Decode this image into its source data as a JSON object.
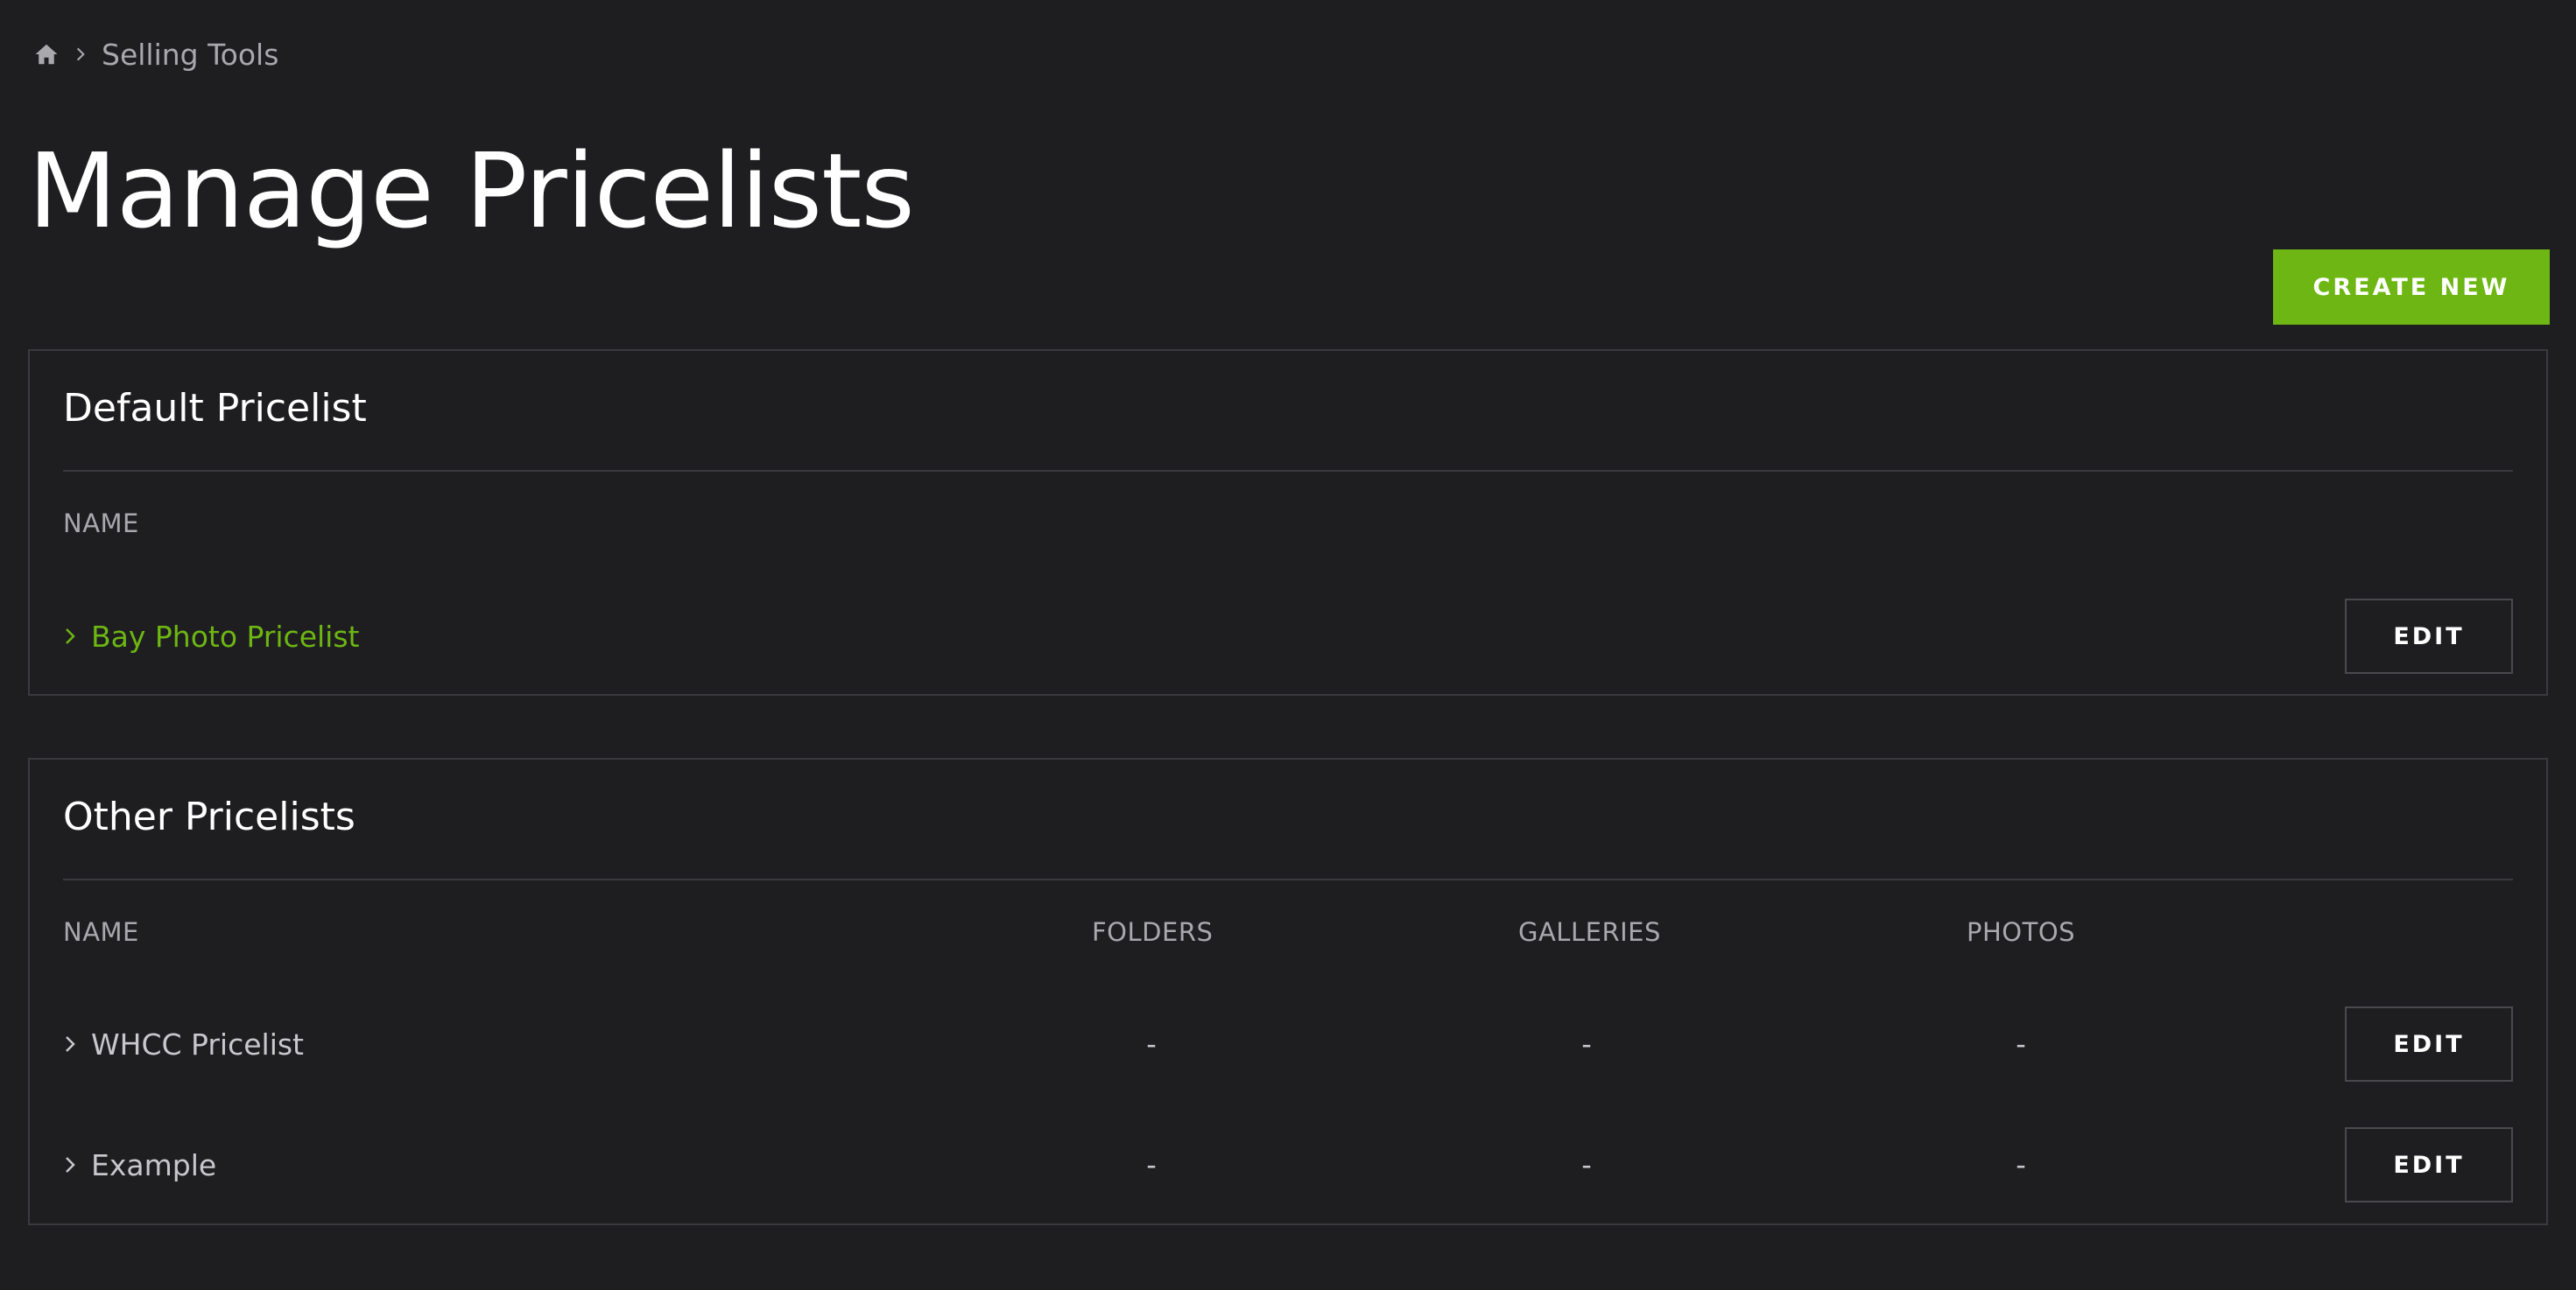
{
  "breadcrumb": {
    "home_icon": "home-icon",
    "separator_icon": "chevron-right-icon",
    "items": [
      {
        "label": "Selling Tools"
      }
    ]
  },
  "page": {
    "title": "Manage Pricelists",
    "create_new_label": "CREATE NEW"
  },
  "colors": {
    "background": "#1e1e20",
    "accent": "#6db613",
    "border": "#3a3a3e",
    "muted_text": "#a8a8ad"
  },
  "default_pricelist": {
    "heading": "Default Pricelist",
    "columns": {
      "name": "NAME"
    },
    "rows": [
      {
        "name": "Bay Photo Pricelist",
        "edit_label": "EDIT"
      }
    ]
  },
  "other_pricelists": {
    "heading": "Other Pricelists",
    "columns": {
      "name": "NAME",
      "folders": "FOLDERS",
      "galleries": "GALLERIES",
      "photos": "PHOTOS"
    },
    "rows": [
      {
        "name": "WHCC Pricelist",
        "folders": "-",
        "galleries": "-",
        "photos": "-",
        "edit_label": "EDIT"
      },
      {
        "name": "Example",
        "folders": "-",
        "galleries": "-",
        "photos": "-",
        "edit_label": "EDIT"
      }
    ]
  }
}
